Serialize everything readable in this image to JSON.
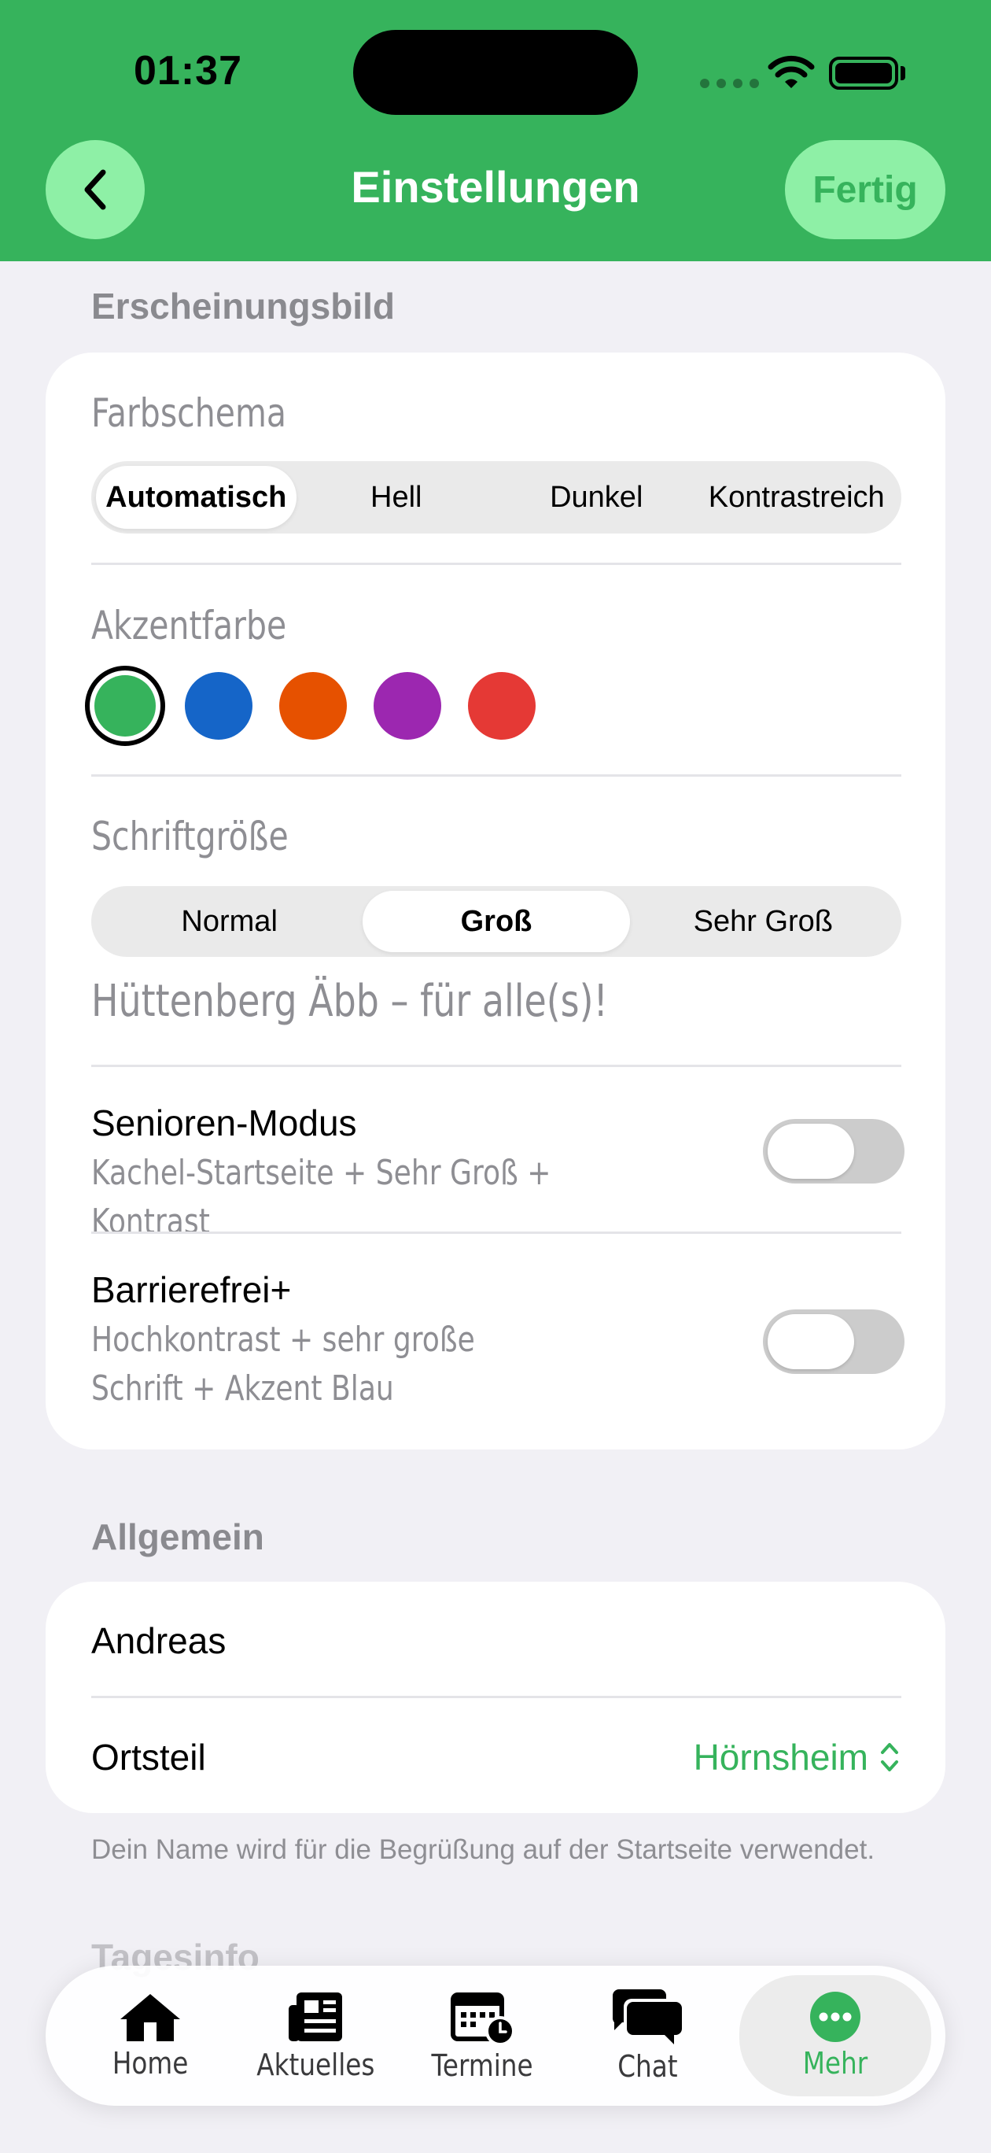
{
  "status_bar": {
    "time": "01:37"
  },
  "header": {
    "title": "Einstellungen",
    "done_label": "Fertig"
  },
  "appearance": {
    "section_label": "Erscheinungsbild",
    "color_scheme": {
      "label": "Farbschema",
      "options": [
        "Automatisch",
        "Hell",
        "Dunkel",
        "Kontrastreich"
      ],
      "selected": "Automatisch"
    },
    "accent": {
      "label": "Akzentfarbe",
      "colors": [
        "#36b35c",
        "#1565c8",
        "#e65100",
        "#9c27b0",
        "#e53935"
      ],
      "selected": "#36b35c"
    },
    "font_size": {
      "label": "Schriftgröße",
      "options": [
        "Normal",
        "Groß",
        "Sehr Groß"
      ],
      "selected": "Groß",
      "preview": "Hüttenberg Äbb – für alle(s)!"
    },
    "senior_mode": {
      "title": "Senioren-Modus",
      "subtitle": "Kachel-Startseite + Sehr Groß + Kontrast",
      "enabled": false
    },
    "accessible_plus": {
      "title": "Barrierefrei+",
      "subtitle": "Hochkontrast + sehr große Schrift + Akzent Blau",
      "enabled": false
    }
  },
  "general": {
    "section_label": "Allgemein",
    "name_value": "Andreas",
    "district_label": "Ortsteil",
    "district_value": "Hörnsheim",
    "footnote": "Dein Name wird für die Begrüßung auf der Startseite verwendet."
  },
  "daily_info": {
    "section_label": "Tagesinfo"
  },
  "tabbar": {
    "items": [
      {
        "label": "Home",
        "icon": "house-icon"
      },
      {
        "label": "Aktuelles",
        "icon": "newspaper-icon"
      },
      {
        "label": "Termine",
        "icon": "calendar-icon"
      },
      {
        "label": "Chat",
        "icon": "chat-bubbles-icon"
      },
      {
        "label": "Mehr",
        "icon": "more-icon"
      }
    ],
    "active": "Mehr"
  },
  "colors": {
    "brand_green": "#36b35c",
    "button_light_green": "#8ef0a6"
  }
}
